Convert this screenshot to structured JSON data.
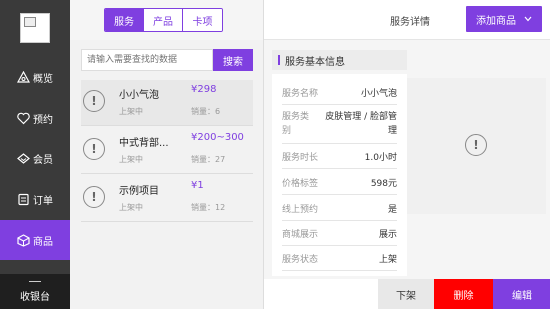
{
  "sidebar": {
    "items": [
      {
        "label": "概览",
        "icon": "overview-icon"
      },
      {
        "label": "预约",
        "icon": "appointment-icon"
      },
      {
        "label": "会员",
        "icon": "member-icon"
      },
      {
        "label": "订单",
        "icon": "order-icon"
      },
      {
        "label": "商品",
        "icon": "product-icon"
      }
    ],
    "active": "商品",
    "cashier_label": "收银台"
  },
  "tabs": [
    {
      "label": "服务",
      "active": true
    },
    {
      "label": "产品",
      "active": false
    },
    {
      "label": "卡项",
      "active": false
    }
  ],
  "search": {
    "placeholder": "请输入需要查找的数据",
    "button_label": "搜索"
  },
  "list": [
    {
      "name": "小小气泡",
      "status": "上架中",
      "price": "¥298",
      "sold": "销量：6"
    },
    {
      "name": "中式背部...",
      "status": "上架中",
      "price": "¥200~300",
      "sold": "销量：27"
    },
    {
      "name": "示例项目",
      "status": "上架中",
      "price": "¥1",
      "sold": "销量：12"
    }
  ],
  "detail": {
    "header_title": "服务详情",
    "add_button": "添加商品",
    "info_title": "服务基本信息",
    "rows": [
      {
        "key": "服务名称",
        "value": "小小气泡"
      },
      {
        "key": "服务类别",
        "value": "皮肤管理 / 脸部管理"
      },
      {
        "key": "服务时长",
        "value": "1.0小时"
      },
      {
        "key": "价格标签",
        "value": "598元"
      },
      {
        "key": "线上预约",
        "value": "是"
      },
      {
        "key": "商城展示",
        "value": "展示"
      },
      {
        "key": "服务状态",
        "value": "上架"
      }
    ],
    "buttons": {
      "off": "下架",
      "delete": "删除",
      "edit": "编辑"
    }
  },
  "colors": {
    "accent": "#7f3fe0",
    "danger": "#ff0000",
    "sidebar": "#3a3a3a"
  }
}
